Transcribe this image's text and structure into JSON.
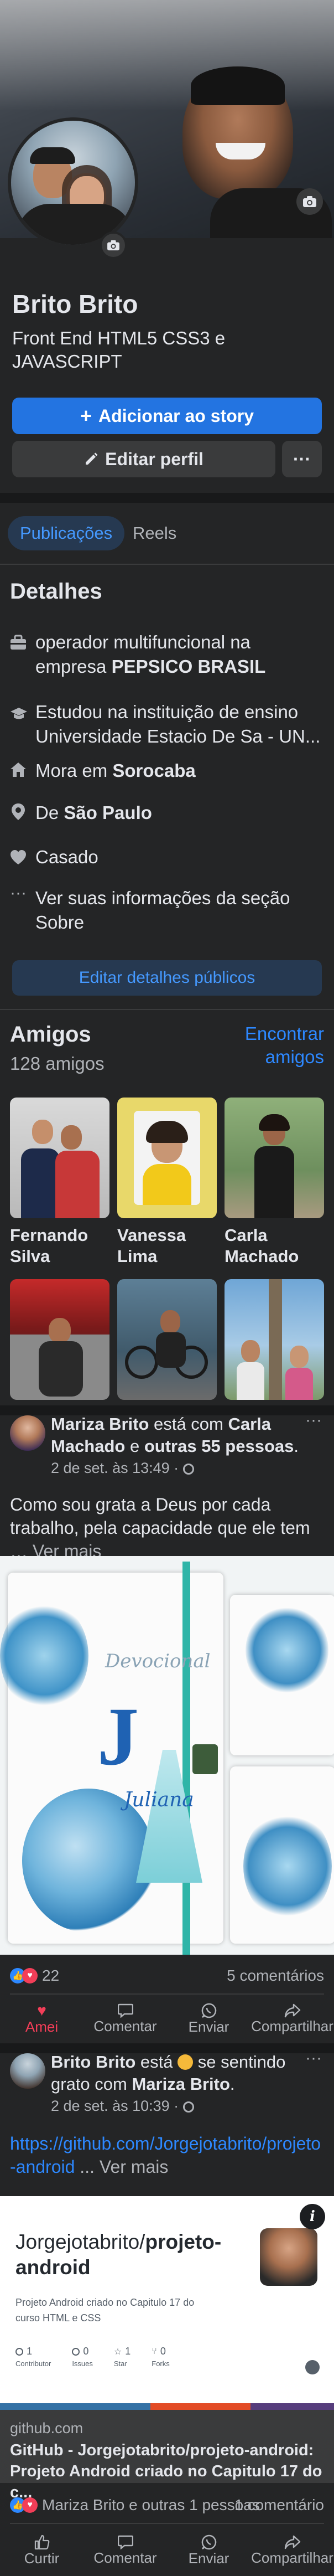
{
  "profile": {
    "name": "Brito Brito",
    "bio": "Front End HTML5 CSS3 e JAVASCRIPT",
    "add_story_label": "Adicionar ao story",
    "edit_profile_label": "Editar perfil",
    "more_label": "···"
  },
  "tabs": [
    {
      "label": "Publicações",
      "active": true
    },
    {
      "label": "Reels",
      "active": false
    }
  ],
  "details": {
    "title": "Detalhes",
    "work_prefix": "operador multifuncional na empresa",
    "work_company": "PEPSICO BRASIL",
    "education": "Estudou na instituição de ensino Universidade Estacio De Sa - UN...",
    "lives_prefix": "Mora em",
    "lives_city": "Sorocaba",
    "from_prefix": "De",
    "from_city": "São Paulo",
    "relationship": "Casado",
    "about": "Ver suas informações da seção Sobre",
    "edit_button": "Editar detalhes públicos"
  },
  "friends": {
    "title": "Amigos",
    "count": "128 amigos",
    "find_label": "Encontrar amigos",
    "list": [
      {
        "name": "Fernando Silva"
      },
      {
        "name": "Vanessa Lima"
      },
      {
        "name": "Carla Machado"
      },
      {
        "name": ""
      },
      {
        "name": ""
      },
      {
        "name": ""
      }
    ]
  },
  "post1": {
    "author": "Mariza Brito",
    "with_text": "está com",
    "tagged": "Carla Machado",
    "and_text": "e",
    "others": "outras 55 pessoas",
    "time": "2 de set. às 13:49 ·",
    "text": "Como sou grata a Deus por cada trabalho, pela capacidade que ele tem",
    "see_more": "… Ver mais",
    "image_text_1": "Devocional",
    "image_text_2": "Juliana",
    "image_letter": "J",
    "reactions_count": "22",
    "comments_count": "5 comentários",
    "actions": [
      {
        "label": "Amei",
        "icon": "heart-icon",
        "active": true
      },
      {
        "label": "Comentar",
        "icon": "comment-icon",
        "active": false
      },
      {
        "label": "Enviar",
        "icon": "whatsapp-icon",
        "active": false
      },
      {
        "label": "Compartilhar",
        "icon": "share-icon",
        "active": false
      }
    ]
  },
  "post2": {
    "author": "Brito Brito",
    "status_text": "está",
    "feeling_text": "se sentindo grato com",
    "with_name": "Mariza Brito",
    "time": "2 de set. às 10:39 ·",
    "link_text": "https://github.com/Jorgejotabrito/projeto-android",
    "see_more": "... Ver mais",
    "card": {
      "repo_owner": "Jorgejotabrito/",
      "repo_name": "projeto-android",
      "description": "Projeto Android criado no Capitulo 17 do curso HTML e CSS",
      "stats": [
        {
          "value": "1",
          "label": "Contributor",
          "icon": "contributor-icon"
        },
        {
          "value": "0",
          "label": "Issues",
          "icon": "issues-icon"
        },
        {
          "value": "1",
          "label": "Star",
          "icon": "star-icon"
        },
        {
          "value": "0",
          "label": "Forks",
          "icon": "fork-icon"
        }
      ]
    },
    "link_domain": "github.com",
    "link_title": "GitHub - Jorgejotabrito/projeto-android: Projeto Android criado no Capitulo 17 do c...",
    "reactions_text": "Mariza Brito e outras 1 pessoas",
    "comments_count": "1 comentário",
    "actions": [
      {
        "label": "Curtir",
        "icon": "like-icon"
      },
      {
        "label": "Comentar",
        "icon": "comment-icon"
      },
      {
        "label": "Enviar",
        "icon": "whatsapp-icon"
      },
      {
        "label": "Compartilhar",
        "icon": "share-icon"
      }
    ]
  },
  "colors": {
    "background": "#242526",
    "separator": "#18191a",
    "accent": "#2d88ff",
    "love": "#f33e58"
  }
}
